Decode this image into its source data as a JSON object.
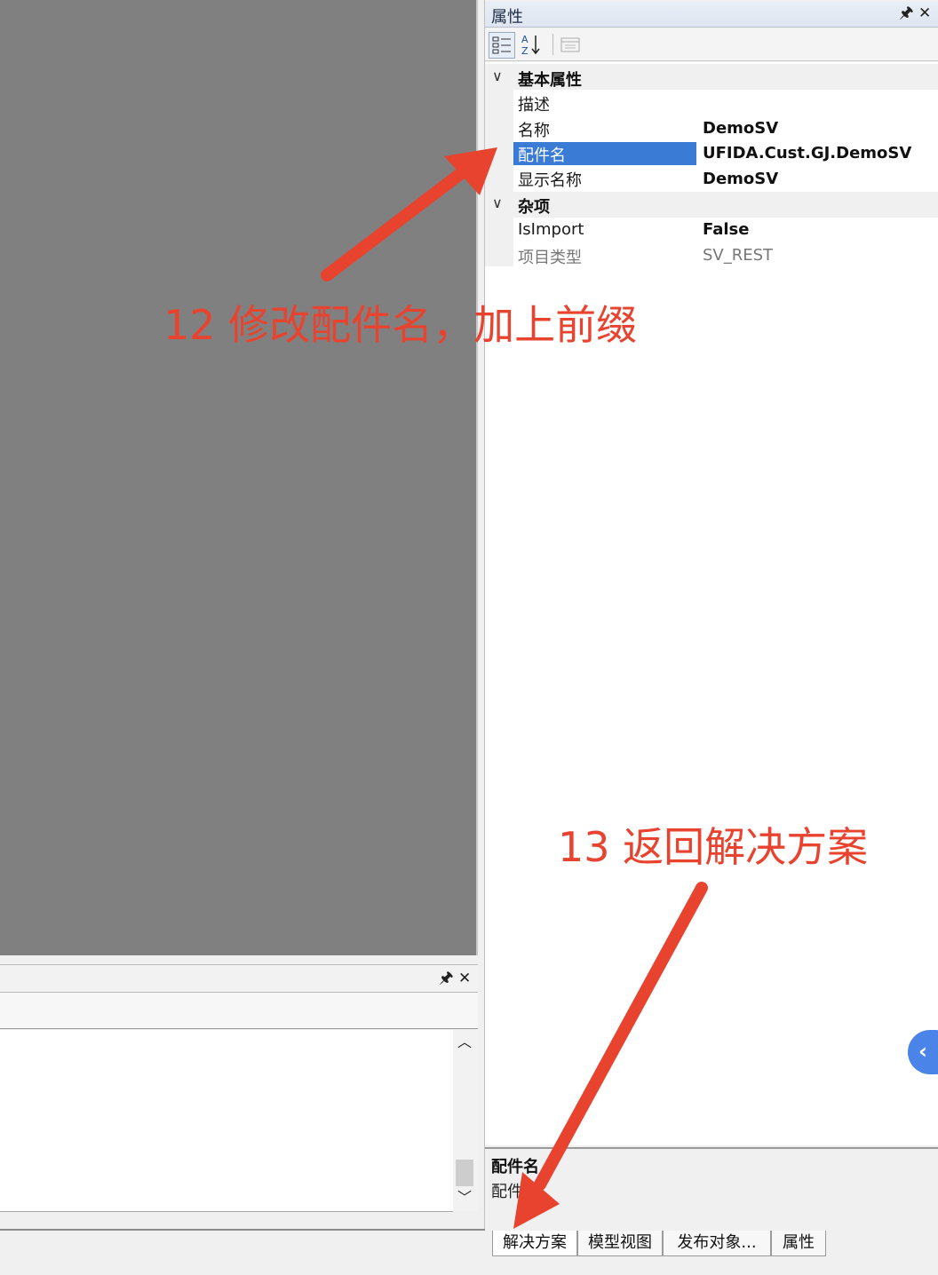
{
  "properties_panel": {
    "title": "属性",
    "pin_icon": "pin-icon",
    "close_icon": "close-icon",
    "categories": [
      {
        "label": "基本属性",
        "rows": [
          {
            "name": "描述",
            "value": ""
          },
          {
            "name": "名称",
            "value": "DemoSV"
          },
          {
            "name": "配件名",
            "value": "UFIDA.Cust.GJ.DemoSV",
            "selected": true
          },
          {
            "name": "显示名称",
            "value": "DemoSV"
          }
        ]
      },
      {
        "label": "杂项",
        "rows": [
          {
            "name": "IsImport",
            "value": "False"
          },
          {
            "name": "项目类型",
            "value": "SV_REST",
            "readonly": true
          }
        ]
      }
    ],
    "description_title": "配件名",
    "description_text": "配件"
  },
  "tabs": [
    {
      "label": "解决方案",
      "active": true
    },
    {
      "label": "模型视图"
    },
    {
      "label": "发布对象..."
    },
    {
      "label": "属性"
    }
  ],
  "annotations": {
    "step12": "12 修改配件名，加上前缀",
    "step13": "13 返回解决方案"
  },
  "colors": {
    "annotation": "#e8432f",
    "selection": "#3a7bd5",
    "editor_bg": "#808080"
  }
}
